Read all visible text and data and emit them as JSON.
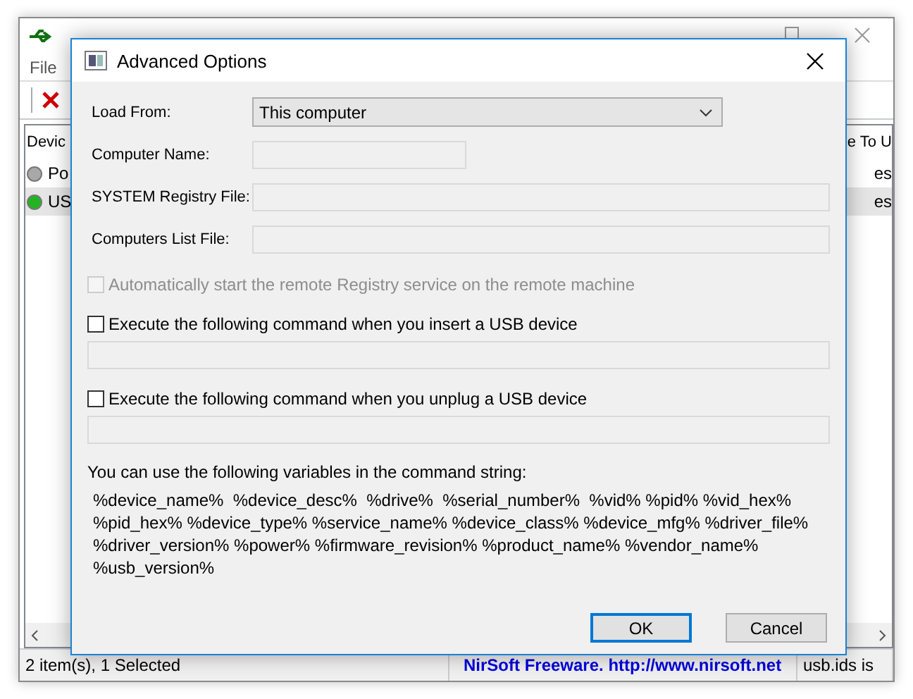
{
  "background_window": {
    "menu": [
      "File"
    ],
    "columns": [
      "Devic",
      "e To U"
    ],
    "rows": [
      {
        "cells": [
          "Po",
          "es"
        ],
        "color": "#a8a8a8",
        "selected": false
      },
      {
        "cells": [
          "US",
          "es"
        ],
        "color": "#22b422",
        "selected": true
      }
    ],
    "status_bar": [
      "2 item(s), 1 Selected",
      "NirSoft Freeware.  http://www.nirsoft.net",
      "usb.ids is"
    ]
  },
  "dialog": {
    "title": "Advanced Options",
    "load_from": {
      "label": "Load From:",
      "value": "This computer"
    },
    "fields": [
      {
        "label": "Computer Name:",
        "kind": "short"
      },
      {
        "label": "SYSTEM Registry File:",
        "kind": "long"
      },
      {
        "label": "Computers List File:",
        "kind": "long"
      }
    ],
    "checkboxes": [
      {
        "label": "Automatically start the remote Registry service on the remote machine",
        "checked": false,
        "disabled": true,
        "kind": "plain"
      },
      {
        "label": "Execute the following command when you insert a USB device",
        "checked": false,
        "disabled": false,
        "kind": "command"
      },
      {
        "label": "Execute the following command when you unplug a USB device",
        "checked": false,
        "disabled": false,
        "kind": "command"
      }
    ],
    "variables_intro": "You can use the following variables in the command string:",
    "variables": [
      "%device_name%  %device_desc%  %drive%  %serial_number%  %vid% %pid% %vid_hex%",
      "%pid_hex% %device_type% %service_name% %device_class% %device_mfg% %driver_file%",
      "%driver_version% %power% %firmware_revision% %product_name% %vendor_name%",
      "%usb_version%"
    ],
    "buttons": [
      {
        "label": "OK",
        "default": true
      },
      {
        "label": "Cancel",
        "default": false
      }
    ]
  }
}
